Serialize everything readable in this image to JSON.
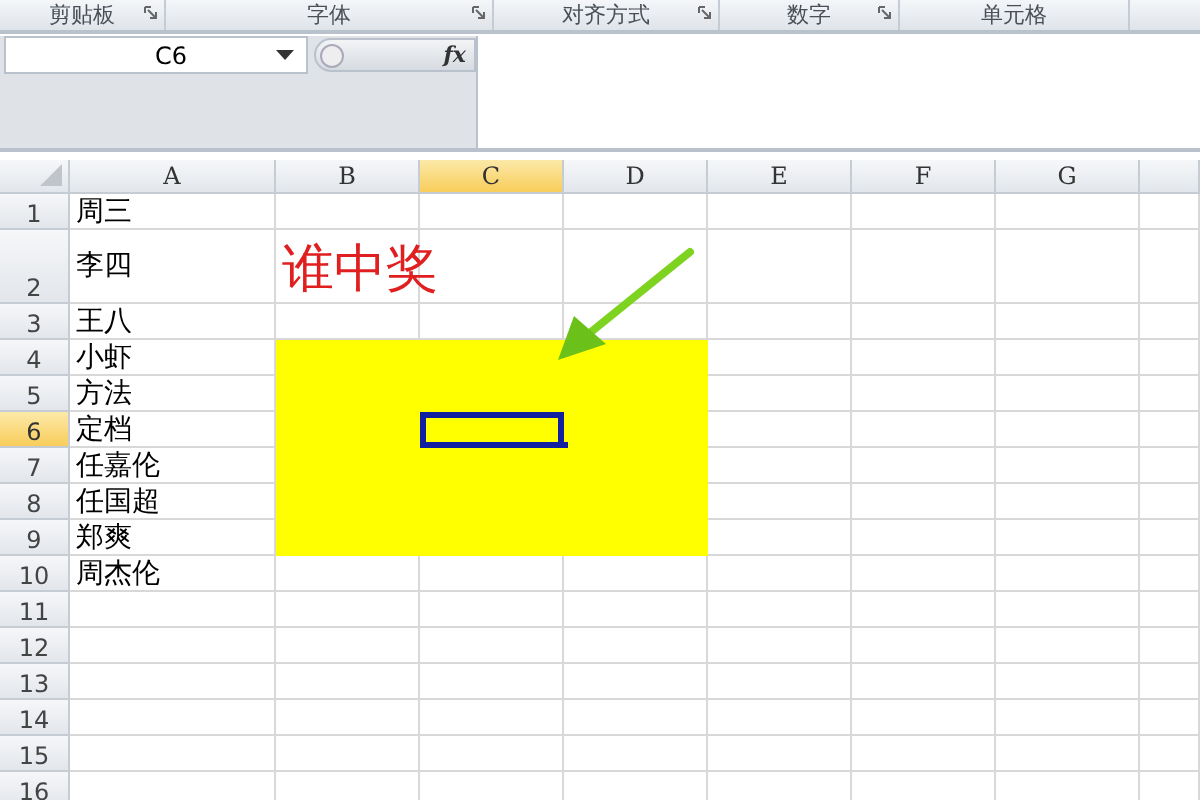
{
  "ribbon_groups": [
    {
      "label": "剪贴板",
      "launcher": true
    },
    {
      "label": "字体",
      "launcher": true
    },
    {
      "label": "对齐方式",
      "launcher": true
    },
    {
      "label": "数字",
      "launcher": true
    },
    {
      "label": "单元格",
      "launcher": false
    }
  ],
  "name_box": {
    "value": "C6"
  },
  "formula_bar": {
    "function_button": "fx"
  },
  "columns": [
    {
      "label": "A",
      "selected": false
    },
    {
      "label": "B",
      "selected": false
    },
    {
      "label": "C",
      "selected": true
    },
    {
      "label": "D",
      "selected": false
    },
    {
      "label": "E",
      "selected": false
    },
    {
      "label": "F",
      "selected": false
    },
    {
      "label": "G",
      "selected": false
    }
  ],
  "rows": [
    {
      "label": "1",
      "selected": false,
      "highlighted": false,
      "cells": [
        "周三"
      ]
    },
    {
      "label": "2",
      "selected": false,
      "highlighted": false,
      "cells": [
        "李四",
        "谁中奖"
      ]
    },
    {
      "label": "3",
      "selected": false,
      "highlighted": false,
      "cells": [
        "王八"
      ]
    },
    {
      "label": "4",
      "selected": false,
      "highlighted": true,
      "cells": [
        "小虾"
      ]
    },
    {
      "label": "5",
      "selected": false,
      "highlighted": true,
      "cells": [
        "方法"
      ]
    },
    {
      "label": "6",
      "selected": true,
      "highlighted": true,
      "cells": [
        "定档"
      ]
    },
    {
      "label": "7",
      "selected": false,
      "highlighted": true,
      "cells": [
        "任嘉伦"
      ]
    },
    {
      "label": "8",
      "selected": false,
      "highlighted": true,
      "cells": [
        "任国超"
      ]
    },
    {
      "label": "9",
      "selected": false,
      "highlighted": true,
      "cells": [
        "郑爽"
      ]
    },
    {
      "label": "10",
      "selected": false,
      "highlighted": false,
      "cells": [
        "周杰伦"
      ]
    },
    {
      "label": "11",
      "selected": false,
      "highlighted": false,
      "cells": []
    },
    {
      "label": "12",
      "selected": false,
      "highlighted": false,
      "cells": []
    },
    {
      "label": "13",
      "selected": false,
      "highlighted": false,
      "cells": []
    },
    {
      "label": "14",
      "selected": false,
      "highlighted": false,
      "cells": []
    },
    {
      "label": "15",
      "selected": false,
      "highlighted": false,
      "cells": []
    },
    {
      "label": "16",
      "selected": false,
      "highlighted": false,
      "cells": []
    }
  ]
}
